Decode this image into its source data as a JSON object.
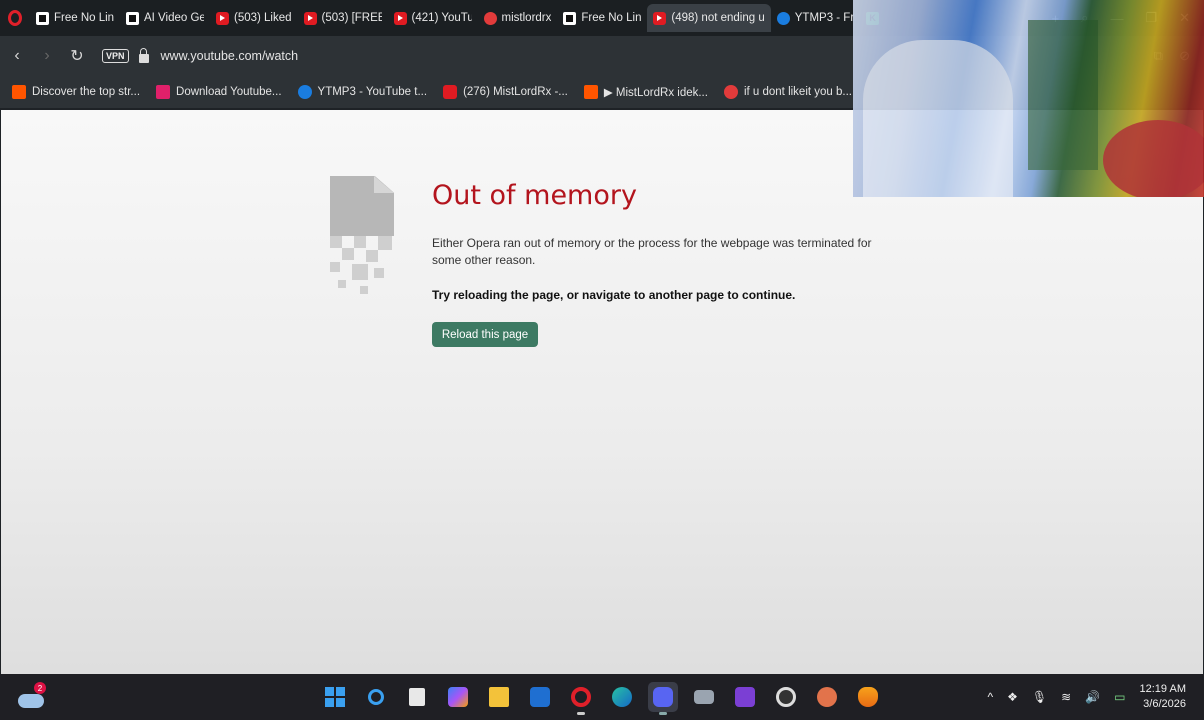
{
  "browser": {
    "tabs": [
      {
        "label": "Free No Lin",
        "favicon": "grid-icon",
        "active": false
      },
      {
        "label": "AI Video Ge",
        "favicon": "grid-icon",
        "active": false
      },
      {
        "label": "(503) Liked",
        "favicon": "youtube-icon",
        "active": false
      },
      {
        "label": "(503) [FREE",
        "favicon": "youtube-icon",
        "active": false
      },
      {
        "label": "(421) YouTu",
        "favicon": "youtube-icon",
        "active": false
      },
      {
        "label": "mistlordrx",
        "favicon": "circle-icon",
        "active": false
      },
      {
        "label": "Free No Lin",
        "favicon": "grid-icon",
        "active": false
      },
      {
        "label": "(498) not ending u",
        "favicon": "youtube-icon",
        "active": true
      },
      {
        "label": "YTMP3 - Fr",
        "favicon": "ytmp3-icon",
        "active": false
      },
      {
        "label": "",
        "favicon": "kick-icon",
        "active": false
      }
    ],
    "address": {
      "vpn_label": "VPN",
      "url": "www.youtube.com/watch"
    },
    "bookmarks": [
      {
        "label": "Discover the top str...",
        "icon": "soundcloud-icon"
      },
      {
        "label": "Download Youtube...",
        "icon": "download-icon"
      },
      {
        "label": "YTMP3 - YouTube t...",
        "icon": "ytmp3-icon"
      },
      {
        "label": "(276) MistLordRx -...",
        "icon": "youtube-icon"
      },
      {
        "label": "▶ MistLordRx idek...",
        "icon": "soundcloud-icon"
      },
      {
        "label": "if u dont likeit you b...",
        "icon": "circle-icon"
      }
    ]
  },
  "error_page": {
    "title": "Out of memory",
    "description": "Either Opera ran out of memory or the process for the webpage was terminated for some other reason.",
    "hint": "Try reloading the page, or navigate to another page to continue.",
    "reload_label": "Reload this page"
  },
  "taskbar": {
    "weather_badge": "2",
    "apps": [
      "start-icon",
      "search-icon",
      "task-view-icon",
      "copilot-icon",
      "file-explorer-icon",
      "outlook-icon",
      "opera-icon",
      "edge-icon",
      "discord-icon",
      "camera-icon",
      "clapper-icon",
      "obs-icon",
      "anime-avatar-icon",
      "fl-studio-icon"
    ],
    "active_app": "discord-icon",
    "time": "12:19 AM",
    "date": "3/6/2026"
  }
}
